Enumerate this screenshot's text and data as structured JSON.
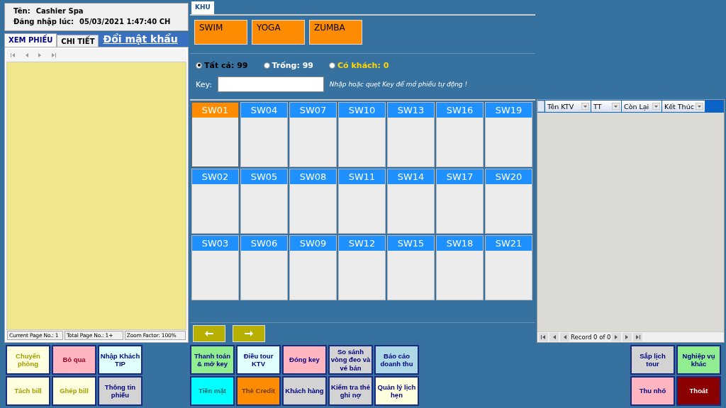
{
  "user": {
    "name_label": "Tên:",
    "name": "Cashier Spa",
    "login_label": "Đăng nhập lúc:",
    "login_time": "05/03/2021 1:47:40 CH"
  },
  "left_tabs": [
    {
      "label": "XEM PHIẾU",
      "selected": true
    },
    {
      "label": "CHI TIẾT",
      "selected": false
    }
  ],
  "change_password_link": "Đổi mật khẩu",
  "report_status": [
    "Current Page No.: 1",
    "Total Page No.: 1+",
    "Zoom Factor: 100%"
  ],
  "zone_tab": "KHU",
  "zones": [
    "SWIM",
    "YOGA",
    "ZUMBA"
  ],
  "filters": [
    {
      "label": "Tất cả: 99",
      "checked": true,
      "color": "#000000"
    },
    {
      "label": "Trống: 99",
      "checked": false,
      "color": "#ffffff"
    },
    {
      "label": "Có khách: 0",
      "checked": false,
      "color": "#ffd700"
    }
  ],
  "key_field": {
    "label": "Key:",
    "hint": "Nhập hoặc quẹt Key để mở phiếu tự động !"
  },
  "rooms": [
    {
      "name": "SW01",
      "selected": true
    },
    {
      "name": "SW02",
      "selected": false
    },
    {
      "name": "SW03",
      "selected": false
    },
    {
      "name": "SW04",
      "selected": false
    },
    {
      "name": "SW05",
      "selected": false
    },
    {
      "name": "SW06",
      "selected": false
    },
    {
      "name": "SW07",
      "selected": false
    },
    {
      "name": "SW08",
      "selected": false
    },
    {
      "name": "SW09",
      "selected": false
    },
    {
      "name": "SW10",
      "selected": false
    },
    {
      "name": "SW11",
      "selected": false
    },
    {
      "name": "SW12",
      "selected": false
    },
    {
      "name": "SW13",
      "selected": false
    },
    {
      "name": "SW14",
      "selected": false
    },
    {
      "name": "SW15",
      "selected": false
    },
    {
      "name": "SW16",
      "selected": false
    },
    {
      "name": "SW17",
      "selected": false
    },
    {
      "name": "SW18",
      "selected": false
    },
    {
      "name": "SW19",
      "selected": false
    },
    {
      "name": "SW20",
      "selected": false
    },
    {
      "name": "SW21",
      "selected": false
    }
  ],
  "staff_table": {
    "columns": [
      "Tên KTV",
      "TT",
      "Còn Lại",
      "Kết Thúc"
    ],
    "record_text": "Record 0 of 0"
  },
  "left_buttons": [
    {
      "label": "Chuyển phòng",
      "color": "#ffffe0",
      "kind": "bill"
    },
    {
      "label": "Bỏ qua",
      "color": "#ffb6c1",
      "kind": "cancel"
    },
    {
      "label": "Nhập Khách TIP",
      "color": "#e0ffff",
      "kind": "action"
    },
    {
      "label": "Tách bill",
      "color": "#ffffe0",
      "kind": "bill"
    },
    {
      "label": "Ghép bill",
      "color": "#ffffe0",
      "kind": "bill"
    },
    {
      "label": "Thông tin phiếu",
      "color": "#d3d3d3",
      "kind": "action"
    }
  ],
  "middle_buttons": [
    {
      "label": "Thanh toán & mở key",
      "color": "#90ee90",
      "kind": "action"
    },
    {
      "label": "Điều tour KTV",
      "color": "#e0ffff",
      "kind": "action"
    },
    {
      "label": "Đóng key",
      "color": "#ffb6c1",
      "kind": "action"
    },
    {
      "label": "So sánh vòng đeo và vé bán",
      "color": "#d3d3d3",
      "kind": "action"
    },
    {
      "label": "Báo cáo doanh thu",
      "color": "#add8e6",
      "kind": "action"
    },
    {
      "label": "Tiền mặt",
      "color": "#00ffff",
      "kind": "payment"
    },
    {
      "label": "Thẻ Credit",
      "color": "#ff8c00",
      "kind": "payment"
    },
    {
      "label": "Khách hàng",
      "color": "#d3d3d3",
      "kind": "action"
    },
    {
      "label": "Kiểm tra thẻ ghi nợ",
      "color": "#d3d3d3",
      "kind": "action"
    },
    {
      "label": "Quản lý lịch hẹn",
      "color": "#ffffe0",
      "kind": "action"
    }
  ],
  "right_buttons": [
    {
      "label": "Sắp lịch tour",
      "color": "#d3d3d3",
      "kind": "action"
    },
    {
      "label": "Nghiệp vụ khác",
      "color": "#90ee90",
      "kind": "action"
    },
    {
      "label": "Thu nhỏ",
      "color": "#ffb6c1",
      "kind": "action"
    },
    {
      "label": "Thoát",
      "color": "#8b0000",
      "kind": "exit"
    }
  ]
}
